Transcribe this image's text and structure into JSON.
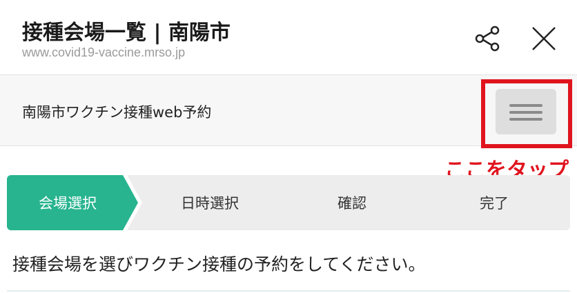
{
  "browser": {
    "title": "接種会場一覧 | 南陽市",
    "url": "www.covid19-vaccine.mrso.jp",
    "share_icon": "share-icon",
    "close_icon": "close-icon"
  },
  "site": {
    "title": "南陽市ワクチン接種web予約",
    "menu_icon": "hamburger-menu-icon"
  },
  "annotation": {
    "text": "ここをタップ",
    "color": "#e0141e"
  },
  "steps": [
    {
      "label": "会場選択",
      "active": true
    },
    {
      "label": "日時選択",
      "active": false
    },
    {
      "label": "確認",
      "active": false
    },
    {
      "label": "完了",
      "active": false
    }
  ],
  "colors": {
    "accent": "#27b48f",
    "step_inactive": "#ededed",
    "highlight": "#e0141e"
  },
  "instructions": "接種会場を選びワクチン接種の予約をしてください。"
}
